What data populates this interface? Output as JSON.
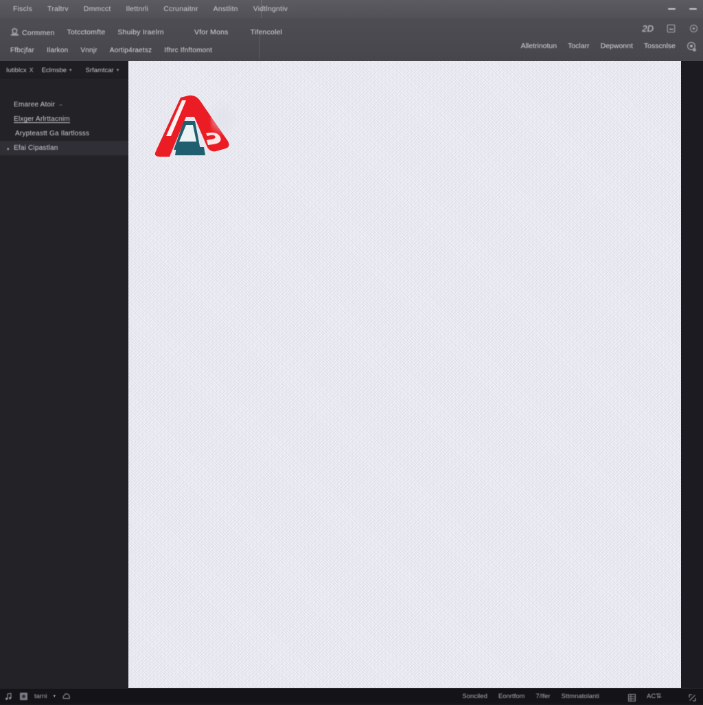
{
  "window": {
    "menu_items": [
      {
        "label": "Fiscls"
      },
      {
        "label": "Traltrv"
      },
      {
        "label": "Dmmcct"
      },
      {
        "label": "Ilettnrli"
      },
      {
        "label": "Ccrunaitnr"
      },
      {
        "label": "Anstlitn"
      },
      {
        "label": "Vidtlngntiv"
      }
    ],
    "controls": [
      {
        "name": "minimize-button",
        "glyph": "—"
      },
      {
        "name": "restore-button",
        "glyph": "—"
      }
    ]
  },
  "ribbon": {
    "row1": [
      {
        "label": "Cormmen",
        "icon": "stamp-icon"
      },
      {
        "label": "Totcctomfte",
        "icon": ""
      },
      {
        "label": "Shuiby Iraelrn",
        "icon": ""
      },
      {
        "label": "Vfor Mons",
        "icon": ""
      },
      {
        "label": "Tifencolel",
        "icon": ""
      }
    ],
    "row2": [
      {
        "label": "Ffbcjfar",
        "icon": ""
      },
      {
        "label": "Ilarkon",
        "icon": ""
      },
      {
        "label": "Vnnjr",
        "icon": ""
      },
      {
        "label": "Aortip4raetsz",
        "icon": ""
      },
      {
        "label": "Ifhrc Ifnftomont",
        "icon": ""
      }
    ],
    "right_group": [
      {
        "label": "Alletrinotun"
      },
      {
        "label": "Toclarr"
      },
      {
        "label": "Depwonnt"
      },
      {
        "label": "Tosscnlse"
      }
    ],
    "help_icon": "help-circle-icon",
    "view_label": "2D",
    "corner_icons": [
      "layers-icon",
      "settings-gear-icon"
    ]
  },
  "sidebar": {
    "tabs": [
      {
        "label": "Iutiblcx",
        "close": "X"
      },
      {
        "label": "Eclmsbe",
        "caret": "▾"
      },
      {
        "label": "Srfamtcar",
        "caret": "▾"
      }
    ],
    "tree": [
      {
        "label": "Emaree Atoir",
        "trail": "–",
        "caret": "",
        "selected": false,
        "underline": false,
        "indent": 1
      },
      {
        "label": "Elxger Arlrttacnim",
        "trail": "",
        "caret": "",
        "selected": false,
        "underline": true,
        "indent": 1
      },
      {
        "label": "Arypteastt Ga Ilartlosss",
        "trail": "",
        "caret": "",
        "selected": false,
        "underline": false,
        "indent": 2
      },
      {
        "label": "Efai Cipastlan",
        "trail": "",
        "caret": "▴",
        "selected": true,
        "underline": false,
        "indent": 1
      }
    ]
  },
  "canvas": {
    "logo_name": "autodesk-style-a-logo",
    "logo_colors": {
      "red": "#ec1c24",
      "teal": "#1f5f70",
      "white": "#ffffff"
    },
    "background": "#f1f1f7"
  },
  "statusbar": {
    "left": [
      {
        "name": "music-note-icon",
        "type": "icon"
      },
      {
        "name": "app-thumbnail-icon",
        "type": "icon"
      },
      {
        "name": "status-app-label",
        "label": "tarni",
        "type": "text"
      },
      {
        "name": "dropdown-caret-icon",
        "type": "caret"
      },
      {
        "name": "cloud-sync-icon",
        "type": "icon"
      }
    ],
    "right": [
      {
        "name": "status-text-1",
        "label": "Sonciled"
      },
      {
        "name": "status-text-2",
        "label": "Eonrtfom"
      },
      {
        "name": "status-text-3",
        "label": "7/lfer"
      },
      {
        "name": "status-text-4",
        "label": "Sttmnatolanti"
      },
      {
        "name": "grid-toggle-icon",
        "label": ""
      },
      {
        "name": "status-mode-label",
        "label": "ACT̸̵̵̶"
      },
      {
        "name": "expand-icon",
        "label": ""
      }
    ]
  },
  "colors": {
    "titlebar": "#55555b",
    "ribbon": "#4a4a50",
    "sidebar": "#232327",
    "selected_row": "#2f2f35",
    "statusbar": "#141418",
    "canvas": "#f1f1f7",
    "logo_red": "#ec1c24",
    "logo_teal": "#1f5f70"
  }
}
